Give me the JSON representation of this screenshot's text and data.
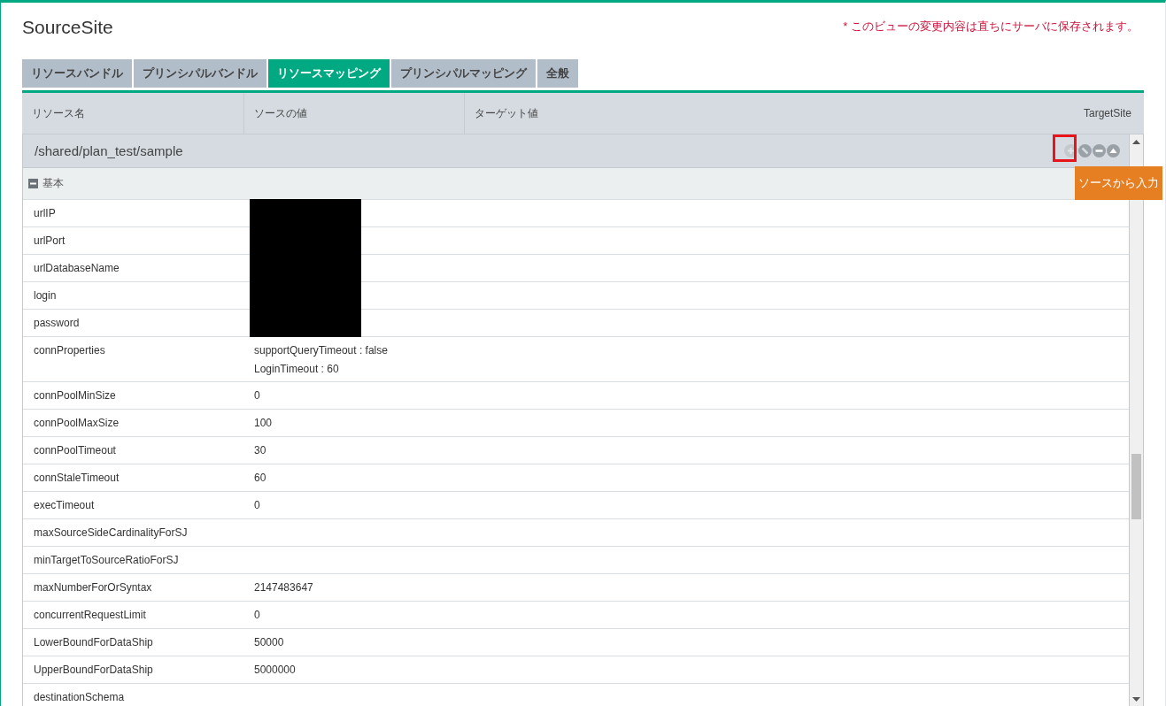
{
  "title": "SourceSite",
  "notice": "* このビューの変更内容は直ちにサーバに保存されます。",
  "tabs": [
    {
      "label": "リソースバンドル",
      "selected": false
    },
    {
      "label": "プリンシパルバンドル",
      "selected": false
    },
    {
      "label": "リソースマッピング",
      "selected": true
    },
    {
      "label": "プリンシパルマッピング",
      "selected": false
    },
    {
      "label": "全般",
      "selected": false
    }
  ],
  "table": {
    "columns": [
      "リソース名",
      "ソースの値",
      "ターゲット値",
      "TargetSite"
    ],
    "resource": {
      "path": "/shared/plan_test/sample",
      "tooltip": "ソースから入力"
    },
    "group": {
      "label": "基本",
      "expanded": true
    },
    "rows": [
      {
        "name": "urlIP",
        "redacted": true
      },
      {
        "name": "urlPort",
        "redacted": true
      },
      {
        "name": "urlDatabaseName",
        "redacted": true
      },
      {
        "name": "login",
        "redacted": true
      },
      {
        "name": "password",
        "redacted": true
      },
      {
        "name": "connProperties",
        "values": [
          "supportQueryTimeout : false",
          "LoginTimeout : 60"
        ]
      },
      {
        "name": "connPoolMinSize",
        "values": [
          "0"
        ]
      },
      {
        "name": "connPoolMaxSize",
        "values": [
          "100"
        ]
      },
      {
        "name": "connPoolTimeout",
        "values": [
          "30"
        ]
      },
      {
        "name": "connStaleTimeout",
        "values": [
          "60"
        ]
      },
      {
        "name": "execTimeout",
        "values": [
          "0"
        ]
      },
      {
        "name": "maxSourceSideCardinalityForSJ"
      },
      {
        "name": "minTargetToSourceRatioForSJ"
      },
      {
        "name": "maxNumberForOrSyntax",
        "values": [
          "2147483647"
        ]
      },
      {
        "name": "concurrentRequestLimit",
        "values": [
          "0"
        ]
      },
      {
        "name": "LowerBoundForDataShip",
        "values": [
          "50000"
        ]
      },
      {
        "name": "UpperBoundForDataShip",
        "values": [
          "5000000"
        ]
      },
      {
        "name": "destinationSchema"
      }
    ]
  }
}
